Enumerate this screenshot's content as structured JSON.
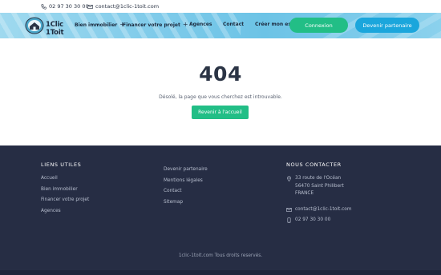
{
  "topbar": {
    "phone": "02 97 30 30 00",
    "email": "contact@1clic-1toit.com"
  },
  "header": {
    "logo_text": "1Clic 1Toit",
    "nav": [
      {
        "label": "Bien immobilier",
        "has_submenu": true
      },
      {
        "label": "Financer votre projet",
        "has_submenu": true
      },
      {
        "label": "Agences",
        "has_submenu": false
      },
      {
        "label": "Contact",
        "has_submenu": false
      },
      {
        "label": "Créer mon espace",
        "has_submenu": false
      }
    ],
    "submenu_symbol": "+",
    "login_label": "Connexion",
    "partner_label": "Devenir partenaire",
    "colors": {
      "login": "#22be86",
      "partner": "#1ba6dc"
    }
  },
  "main": {
    "code": "404",
    "message": "Désolé, la page que vous cherchez est introuvable.",
    "back_label": "Revenir à l'accueil"
  },
  "footer": {
    "useful_links": {
      "title": "LIENS UTILES",
      "items": [
        "Accueil",
        "Bien immobilier",
        "Financer votre projet",
        "Agences"
      ]
    },
    "more_links": {
      "items": [
        "Devenir partenaire",
        "Mentions légales",
        "Contact",
        "Sitemap"
      ]
    },
    "contact": {
      "title": "NOUS CONTACTER",
      "address": [
        "33 route de l'Océan",
        "56470 Saint Philibert",
        "FRANCE"
      ],
      "email": "contact@1clic-1toit.com",
      "phone": "02 97 30 30 00"
    },
    "copyright": "1clic-1toit.com Tous droits reservés."
  }
}
